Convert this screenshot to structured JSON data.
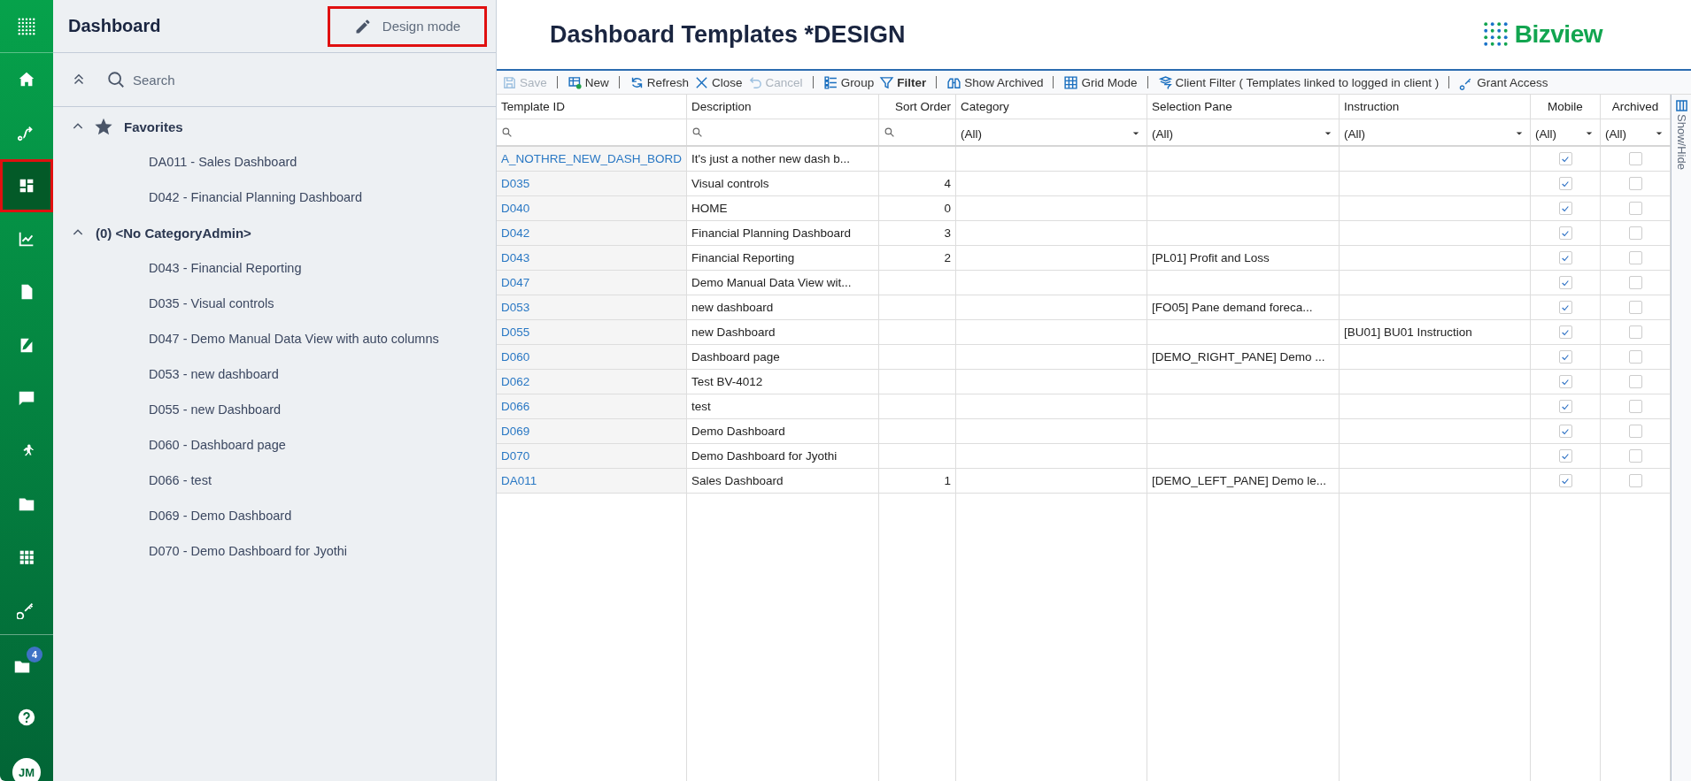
{
  "nav_rail": {
    "top": [
      {
        "kind": "apps",
        "selected": false
      },
      {
        "kind": "home",
        "selected": false
      },
      {
        "kind": "route",
        "selected": false
      },
      {
        "kind": "dashboard",
        "selected": true,
        "outlined": true
      },
      {
        "kind": "chart",
        "selected": false
      },
      {
        "kind": "document",
        "selected": false
      },
      {
        "kind": "edit",
        "selected": false
      },
      {
        "kind": "chat",
        "selected": false
      },
      {
        "kind": "run",
        "selected": false
      },
      {
        "kind": "contact",
        "selected": false
      },
      {
        "kind": "grid",
        "selected": false
      },
      {
        "kind": "key",
        "selected": false
      }
    ],
    "bottom": [
      {
        "kind": "folder",
        "badge": "4"
      },
      {
        "kind": "help"
      },
      {
        "kind": "avatar",
        "initials": "JM"
      }
    ]
  },
  "sidebar": {
    "title": "Dashboard",
    "design_mode_button": {
      "label": "Design mode",
      "outlined": true
    },
    "search": {
      "placeholder": "Search"
    },
    "groups": [
      {
        "label": "Favorites",
        "star": true,
        "expanded": true,
        "children": [
          {
            "label": "DA011 - Sales Dashboard"
          },
          {
            "label": "D042 - Financial Planning Dashboard"
          }
        ]
      },
      {
        "label": "(0) <No CategoryAdmin>",
        "star": false,
        "expanded": true,
        "children": [
          {
            "label": "D043 - Financial Reporting"
          },
          {
            "label": "D035 - Visual controls"
          },
          {
            "label": "D047 - Demo Manual Data View with auto columns"
          },
          {
            "label": "D053 - new dashboard"
          },
          {
            "label": "D055 - new Dashboard"
          },
          {
            "label": "D060 - Dashboard page"
          },
          {
            "label": "D066 - test"
          },
          {
            "label": "D069 - Demo Dashboard"
          },
          {
            "label": "D070 - Demo Dashboard for Jyothi"
          }
        ]
      }
    ]
  },
  "page": {
    "title": "Dashboard Templates *DESIGN",
    "logo": "Bizview"
  },
  "toolbar": {
    "groups": [
      [
        {
          "label": "Save",
          "kind": "save",
          "disabled": true,
          "bold": false
        }
      ],
      [
        {
          "label": "New",
          "kind": "new",
          "disabled": false,
          "bold": false
        }
      ],
      [
        {
          "label": "Refresh",
          "kind": "refresh",
          "disabled": false,
          "bold": false
        },
        {
          "label": "Close",
          "kind": "close",
          "disabled": false,
          "bold": false
        },
        {
          "label": "Cancel",
          "kind": "undo",
          "disabled": true,
          "bold": false
        }
      ],
      [
        {
          "label": "Group",
          "kind": "group",
          "disabled": false,
          "bold": false
        },
        {
          "label": "Filter",
          "kind": "filter",
          "disabled": false,
          "bold": true
        }
      ],
      [
        {
          "label": "Show Archived",
          "kind": "binoculars",
          "disabled": false,
          "bold": false
        }
      ],
      [
        {
          "label": "Grid Mode",
          "kind": "grid",
          "disabled": false,
          "bold": false
        }
      ],
      [
        {
          "label": "Client Filter ( Templates linked to logged in client )",
          "kind": "client-filter",
          "disabled": false,
          "bold": false
        }
      ],
      [
        {
          "label": "Grant Access",
          "kind": "key",
          "disabled": false,
          "bold": false
        }
      ]
    ]
  },
  "table": {
    "columns": [
      {
        "label": "Template ID",
        "kind": "search"
      },
      {
        "label": "Description",
        "kind": "search"
      },
      {
        "label": "Sort Order",
        "kind": "search"
      },
      {
        "label": "Category",
        "kind": "dropdown",
        "filter_value": "(All)"
      },
      {
        "label": "Selection Pane",
        "kind": "dropdown",
        "filter_value": "(All)"
      },
      {
        "label": "Instruction",
        "kind": "dropdown",
        "filter_value": "(All)"
      },
      {
        "label": "Mobile",
        "kind": "dropdown",
        "filter_value": "(All)"
      },
      {
        "label": "Archived",
        "kind": "dropdown",
        "filter_value": "(All)"
      }
    ],
    "rows": [
      {
        "template_id": "A_NOTHRE_NEW_DASH_BORD",
        "description": "It's just a nother new dash b...",
        "mobile": true,
        "archived": false
      },
      {
        "template_id": "D035",
        "description": "Visual controls",
        "sort_order": "4",
        "mobile": true,
        "archived": false
      },
      {
        "template_id": "D040",
        "description": "HOME",
        "sort_order": "0",
        "mobile": true,
        "archived": false
      },
      {
        "template_id": "D042",
        "description": "Financial Planning Dashboard",
        "sort_order": "3",
        "mobile": true,
        "archived": false
      },
      {
        "template_id": "D043",
        "description": "Financial Reporting",
        "sort_order": "2",
        "selection_pane": "[PL01] Profit and Loss",
        "mobile": true,
        "archived": false
      },
      {
        "template_id": "D047",
        "description": "Demo Manual Data View wit...",
        "mobile": true,
        "archived": false
      },
      {
        "template_id": "D053",
        "description": "new dashboard",
        "selection_pane": "[FO05] Pane demand foreca...",
        "mobile": true,
        "archived": false
      },
      {
        "template_id": "D055",
        "description": "new Dashboard",
        "instruction": "[BU01] BU01 Instruction",
        "mobile": true,
        "archived": false
      },
      {
        "template_id": "D060",
        "description": "Dashboard page",
        "selection_pane": "[DEMO_RIGHT_PANE] Demo ...",
        "mobile": true,
        "archived": false
      },
      {
        "template_id": "D062",
        "description": "Test BV-4012",
        "mobile": true,
        "archived": false
      },
      {
        "template_id": "D066",
        "description": "test",
        "mobile": true,
        "archived": false
      },
      {
        "template_id": "D069",
        "description": "Demo Dashboard",
        "mobile": true,
        "archived": false
      },
      {
        "template_id": "D070",
        "description": "Demo Dashboard for Jyothi",
        "mobile": true,
        "archived": false
      },
      {
        "template_id": "DA011",
        "description": "Sales Dashboard",
        "sort_order": "1",
        "selection_pane": "[DEMO_LEFT_PANE] Demo le...",
        "mobile": true,
        "archived": false
      }
    ]
  },
  "side_panel_toggle": {
    "label": "Show/Hide"
  }
}
